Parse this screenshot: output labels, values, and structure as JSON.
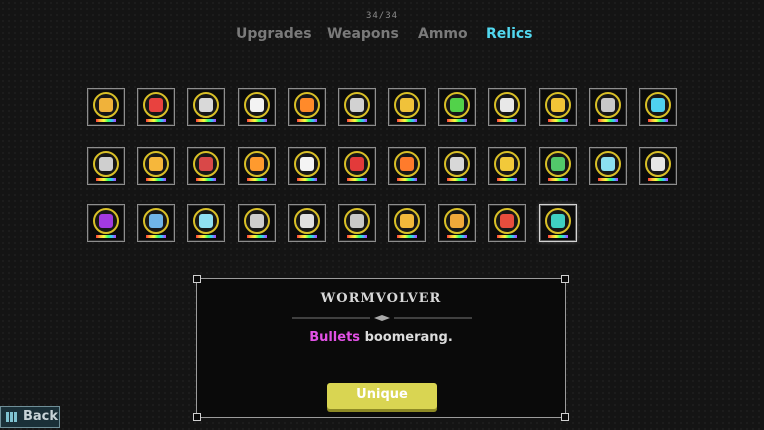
{
  "header": {
    "count": "34/34"
  },
  "tabs": [
    {
      "label": "Upgrades",
      "active": false
    },
    {
      "label": "Weapons",
      "active": false
    },
    {
      "label": "Ammo",
      "active": false
    },
    {
      "label": "Relics",
      "active": true
    }
  ],
  "relics": [
    {
      "color": "#f0b23a"
    },
    {
      "color": "#e8423f"
    },
    {
      "color": "#d9d9d9"
    },
    {
      "color": "#f3f3f3"
    },
    {
      "color": "#ff8a2a"
    },
    {
      "color": "#d2d2d2"
    },
    {
      "color": "#f0c23a"
    },
    {
      "color": "#52d24a"
    },
    {
      "color": "#e8e8e8"
    },
    {
      "color": "#f2c437"
    },
    {
      "color": "#c9c9c9"
    },
    {
      "color": "#4fd1f0"
    },
    {
      "color": "#cfcfcf"
    },
    {
      "color": "#f6b73b"
    },
    {
      "color": "#d94848"
    },
    {
      "color": "#ff9a2e"
    },
    {
      "color": "#f4f4f4"
    },
    {
      "color": "#e33a3a"
    },
    {
      "color": "#ff7b2c"
    },
    {
      "color": "#d8d8d8"
    },
    {
      "color": "#f2c93a"
    },
    {
      "color": "#52c86a"
    },
    {
      "color": "#8be0f0"
    },
    {
      "color": "#e6e6e6"
    },
    {
      "color": "#a23ae0"
    },
    {
      "color": "#6fb5e8"
    },
    {
      "color": "#8fe0f2"
    },
    {
      "color": "#cdcdcd"
    },
    {
      "color": "#e0e0e0"
    },
    {
      "color": "#c8c8c8"
    },
    {
      "color": "#f2b93b"
    },
    {
      "color": "#f0a93a"
    },
    {
      "color": "#e84d3d"
    },
    {
      "color": "#3fd0c2"
    }
  ],
  "selected_index": 33,
  "detail": {
    "name": "WORMVOLVER",
    "keyword": "Bullets",
    "description": " boomerang.",
    "rarity": "Unique"
  },
  "footer": {
    "back_label": "Back"
  }
}
